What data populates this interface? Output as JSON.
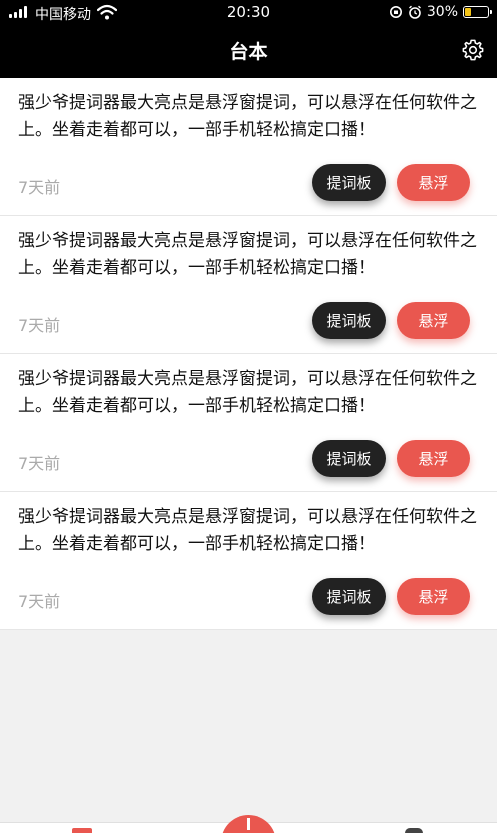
{
  "status_bar": {
    "carrier": "中国移动",
    "time": "20:30",
    "battery_text": "30%",
    "battery_level": 0.3,
    "battery_color": "#f5c518"
  },
  "header": {
    "title": "台本",
    "settings_icon": "gear-icon"
  },
  "scripts": [
    {
      "text": "强少爷提词器最大亮点是悬浮窗提词，可以悬浮在任何软件之上。坐着走着都可以，一部手机轻松搞定口播！",
      "time": "7天前",
      "teleprompter_label": "提词板",
      "float_label": "悬浮"
    },
    {
      "text": "强少爷提词器最大亮点是悬浮窗提词，可以悬浮在任何软件之上。坐着走着都可以，一部手机轻松搞定口播！",
      "time": "7天前",
      "teleprompter_label": "提词板",
      "float_label": "悬浮"
    },
    {
      "text": "强少爷提词器最大亮点是悬浮窗提词，可以悬浮在任何软件之上。坐着走着都可以，一部手机轻松搞定口播！",
      "time": "7天前",
      "teleprompter_label": "提词板",
      "float_label": "悬浮"
    },
    {
      "text": "强少爷提词器最大亮点是悬浮窗提词，可以悬浮在任何软件之上。坐着走着都可以，一部手机轻松搞定口播！",
      "time": "7天前",
      "teleprompter_label": "提词板",
      "float_label": "悬浮"
    }
  ],
  "colors": {
    "accent": "#e9574f",
    "dark_button": "#222222",
    "header_bg": "#000000"
  },
  "tab_bar": {
    "add_icon": "plus-icon"
  }
}
